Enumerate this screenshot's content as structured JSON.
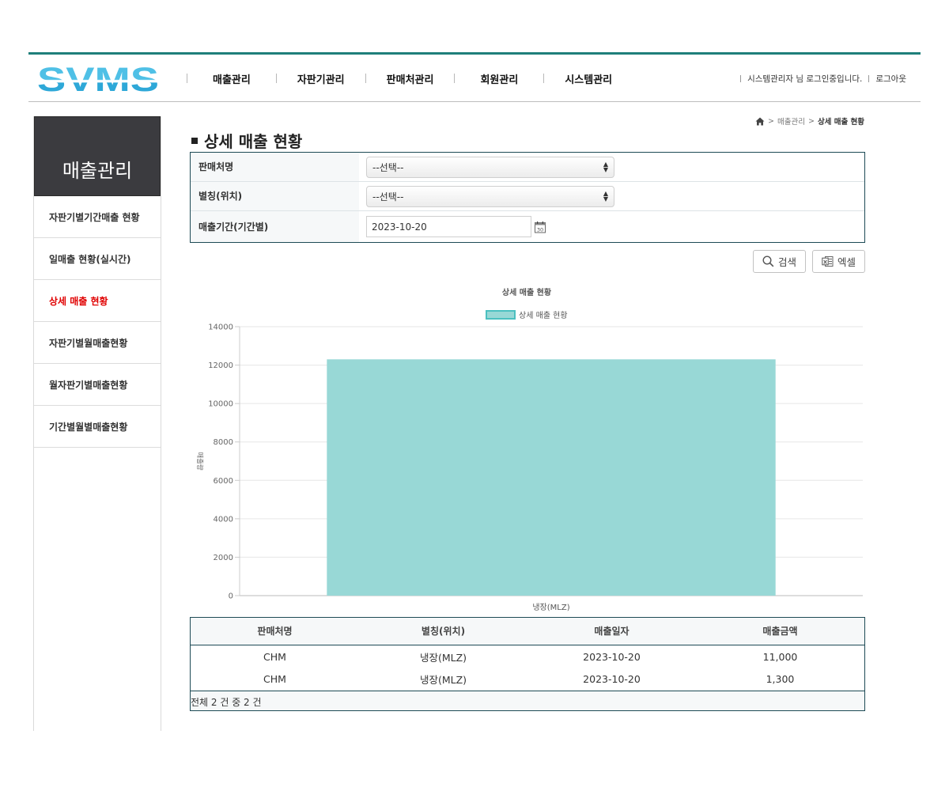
{
  "header": {
    "logo": "SVMS",
    "nav": [
      "매출관리",
      "자판기관리",
      "판매처관리",
      "회원관리",
      "시스템관리"
    ],
    "user_text": "시스템관리자 님 로그인중입니다.",
    "logout": "로그아웃"
  },
  "sidebar": {
    "title": "매출관리",
    "items": [
      "자판기별기간매출 현황",
      "일매출 현황(실시간)",
      "상세 매출 현황",
      "자판기별월매출현황",
      "월자판기별매출현황",
      "기간별월별매출현황"
    ],
    "active_index": 2
  },
  "breadcrumb": {
    "level1": "매출관리",
    "current": "상세 매출 현황"
  },
  "page": {
    "title": "상세 매출 현황"
  },
  "search": {
    "seller_label": "판매처명",
    "seller_value": "--선택--",
    "alias_label": "별칭(위치)",
    "alias_value": "--선택--",
    "period_label_1": "매출기간",
    "period_label_2": "(기간별)",
    "date_value": "2023-10-20"
  },
  "buttons": {
    "search": "검색",
    "excel": "엑셀"
  },
  "chart_data": {
    "type": "bar",
    "title": "상세 매출 현황",
    "categories": [
      "냉장(MLZ)"
    ],
    "series": [
      {
        "name": "상세 매출 현황",
        "values": [
          12300
        ]
      }
    ],
    "ylabel": "매출량",
    "xlabel": "",
    "ylim": [
      0,
      14000
    ],
    "yticks": [
      0,
      2000,
      4000,
      6000,
      8000,
      10000,
      12000,
      14000
    ],
    "grid": true,
    "legend": "top-center",
    "bar_color": "#98d8d6",
    "legend_border": "#4bc0c0"
  },
  "table": {
    "headers": [
      "판매처명",
      "별칭(위치)",
      "매출일자",
      "매출금액"
    ],
    "rows": [
      [
        "CHM",
        "냉장(MLZ)",
        "2023-10-20",
        "11,000"
      ],
      [
        "CHM",
        "냉장(MLZ)",
        "2023-10-20",
        "1,300"
      ]
    ],
    "footer": "전체 2 건 중 2 건"
  }
}
